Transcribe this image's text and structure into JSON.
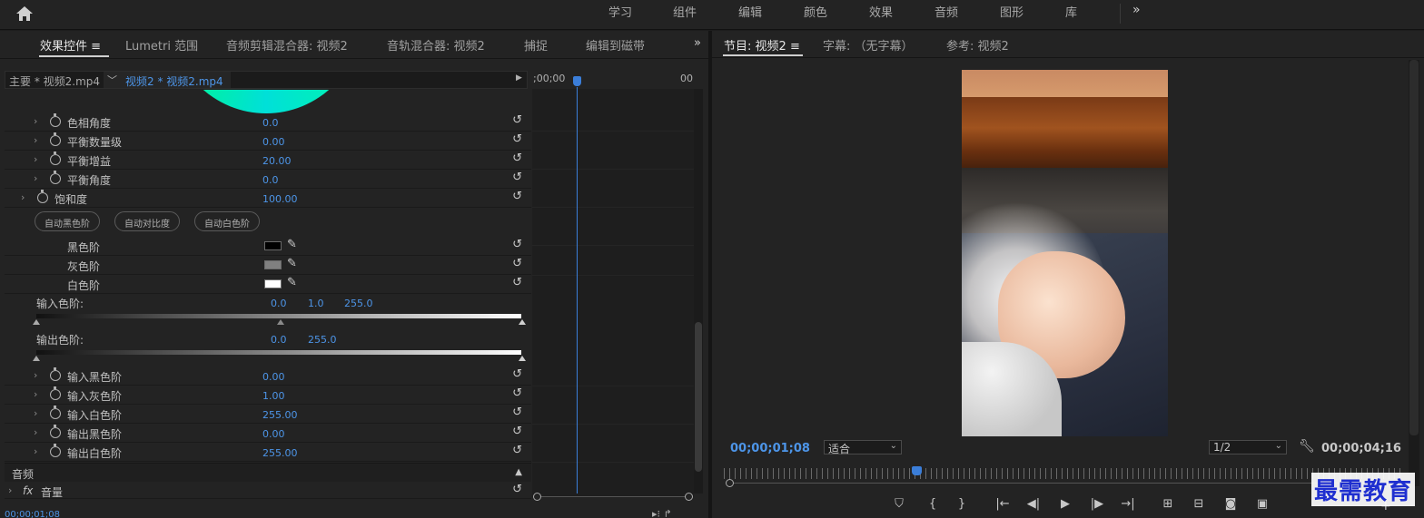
{
  "workspaces": [
    "学习",
    "组件",
    "编辑",
    "颜色",
    "效果",
    "音频",
    "图形",
    "库"
  ],
  "left_panel": {
    "tabs": [
      "效果控件",
      "Lumetri 范围",
      "音频剪辑混合器: 视频2",
      "音轨混合器: 视频2",
      "捕捉",
      "编辑到磁带"
    ],
    "menu_icon": "≡",
    "clip_master": "主要 * 视频2.mp4",
    "clip_sequence": "视频2 * 视频2.mp4",
    "params": [
      {
        "label": "色相角度",
        "value": "0.0"
      },
      {
        "label": "平衡数量级",
        "value": "0.00"
      },
      {
        "label": "平衡增益",
        "value": "20.00"
      },
      {
        "label": "平衡角度",
        "value": "0.0"
      },
      {
        "label": "饱和度",
        "value": "100.00"
      }
    ],
    "auto_buttons": [
      "自动黑色阶",
      "自动对比度",
      "自动白色阶"
    ],
    "levels": [
      {
        "label": "黑色阶",
        "swatch": "#000000"
      },
      {
        "label": "灰色阶",
        "swatch": "#808080"
      },
      {
        "label": "白色阶",
        "swatch": "#ffffff"
      }
    ],
    "input_levels": {
      "label": "输入色阶:",
      "values": [
        "0.0",
        "1.0",
        "255.0"
      ]
    },
    "output_levels": {
      "label": "输出色阶:",
      "values": [
        "0.0",
        "255.0"
      ]
    },
    "params2": [
      {
        "label": "输入黑色阶",
        "value": "0.00"
      },
      {
        "label": "输入灰色阶",
        "value": "1.00"
      },
      {
        "label": "输入白色阶",
        "value": "255.00"
      },
      {
        "label": "输出黑色阶",
        "value": "0.00"
      },
      {
        "label": "输出白色阶",
        "value": "255.00"
      }
    ],
    "audio_section": "音频",
    "volume": {
      "fx": "fx",
      "label": "音量"
    },
    "timeline_tc_start": ";00;00",
    "timeline_tc_end": "00",
    "current_tc": "00;00;01;08"
  },
  "right_panel": {
    "tabs": [
      "节目: 视频2",
      "字幕: （无字幕）",
      "参考: 视频2"
    ],
    "menu_icon": "≡",
    "current_tc": "00;00;01;08",
    "fit": "适合",
    "resolution": "1/2",
    "duration_tc": "00;00;04;16",
    "transport": [
      "marker",
      "mark-in",
      "mark-out",
      "go-to-in",
      "step-back",
      "play",
      "step-forward",
      "go-to-out",
      "lift",
      "extract",
      "export-frame",
      "compare"
    ]
  },
  "watermark": "最需教育",
  "accent": "#4d95e8"
}
